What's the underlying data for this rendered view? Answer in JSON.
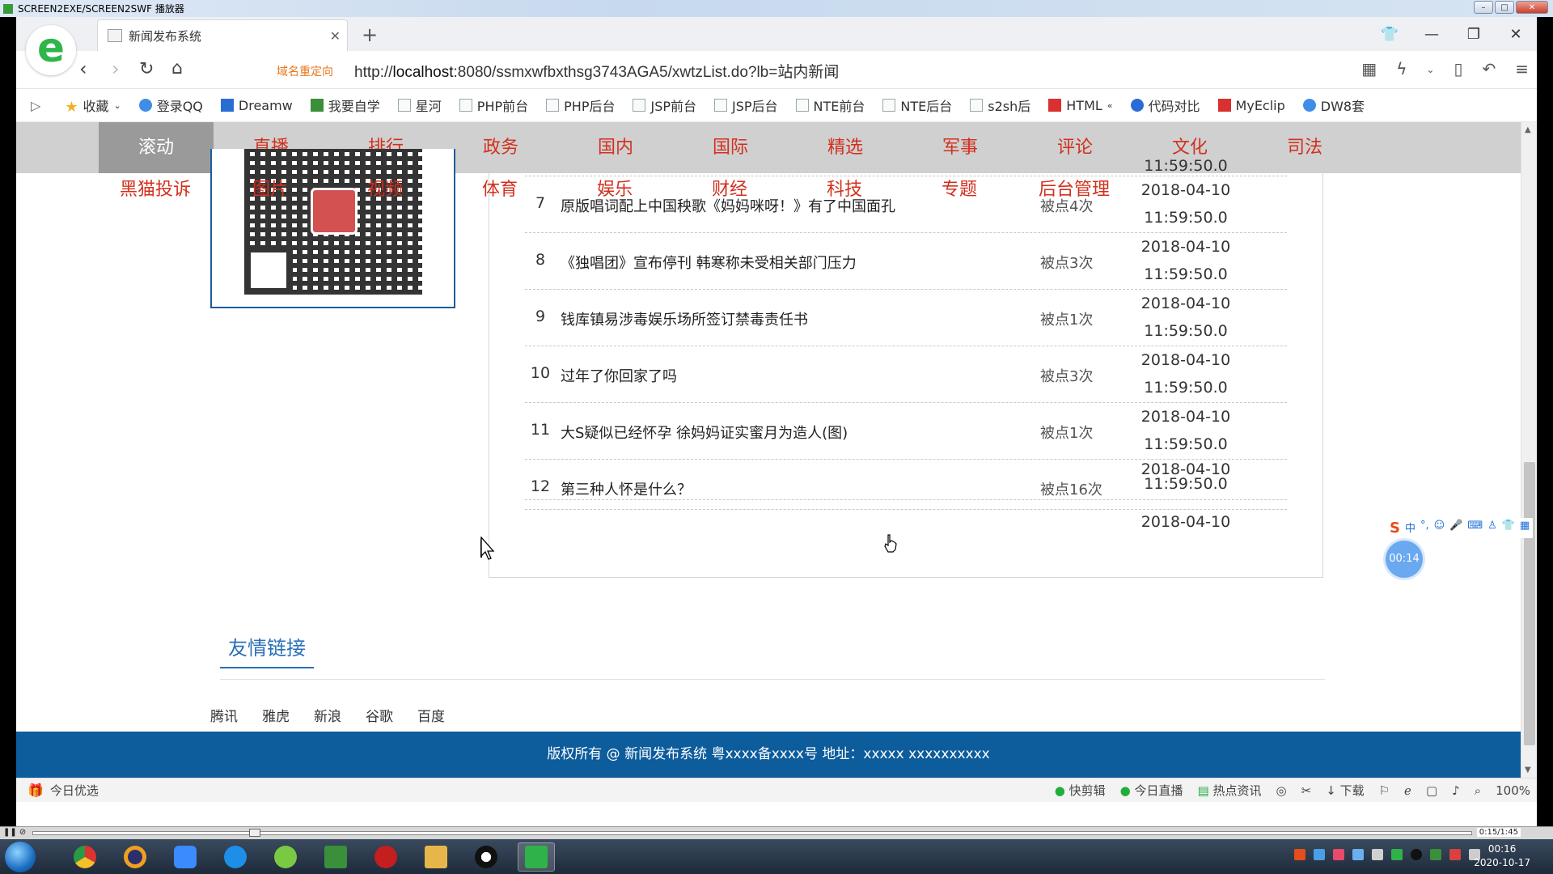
{
  "player": {
    "title": "SCREEN2EXE/SCREEN2SWF 播放器",
    "time": "0:15/1:45"
  },
  "browser": {
    "tab_title": "新闻发布系统",
    "redirect_label": "域名重定向",
    "url_prefix": "http://",
    "url_host": "localhost",
    "url_rest": ":8080/ssmxwfbxthsg3743AGA5/xwtzList.do?lb=站内新闻"
  },
  "bookmarks": [
    {
      "label": "收藏",
      "icon": "star-icon"
    },
    {
      "label": "登录QQ",
      "icon": "qq-icon"
    },
    {
      "label": "Dreamw",
      "icon": "dreamweaver-icon"
    },
    {
      "label": "我要自学",
      "icon": "book-icon"
    },
    {
      "label": "星河",
      "icon": "page-icon"
    },
    {
      "label": "PHP前台",
      "icon": "page-icon"
    },
    {
      "label": "PHP后台",
      "icon": "page-icon"
    },
    {
      "label": "JSP前台",
      "icon": "page-icon"
    },
    {
      "label": "JSP后台",
      "icon": "page-icon"
    },
    {
      "label": "NTE前台",
      "icon": "page-icon"
    },
    {
      "label": "NTE后台",
      "icon": "page-icon"
    },
    {
      "label": "s2sh后",
      "icon": "image-icon"
    },
    {
      "label": "HTML",
      "icon": "html-icon"
    },
    {
      "label": "代码对比",
      "icon": "compare-icon"
    },
    {
      "label": "MyEclip",
      "icon": "myeclipse-icon"
    },
    {
      "label": "DW8套",
      "icon": "gear-icon"
    }
  ],
  "menu": {
    "row1": [
      "滚动",
      "直播",
      "排行",
      "政务",
      "国内",
      "国际",
      "精选",
      "军事",
      "评论",
      "文化",
      "司法"
    ],
    "row2": [
      "黑猫投诉",
      "图片",
      "视频",
      "体育",
      "娱乐",
      "财经",
      "科技",
      "专题",
      "后台管理"
    ]
  },
  "news": {
    "partial_top_time": "11:59:50.0",
    "rows": [
      {
        "num": "7",
        "title": "原版唱词配上中国秧歌《妈妈咪呀！》有了中国面孔",
        "hits": "被点4次",
        "date": "2018-04-10",
        "time": "11:59:50.0"
      },
      {
        "num": "8",
        "title": "《独唱团》宣布停刊 韩寒称未受相关部门压力",
        "hits": "被点3次",
        "date": "2018-04-10",
        "time": "11:59:50.0"
      },
      {
        "num": "9",
        "title": "钱库镇易涉毒娱乐场所签订禁毒责任书",
        "hits": "被点1次",
        "date": "2018-04-10",
        "time": "11:59:50.0"
      },
      {
        "num": "10",
        "title": "过年了你回家了吗",
        "hits": "被点3次",
        "date": "2018-04-10",
        "time": "11:59:50.0"
      },
      {
        "num": "11",
        "title": "大S疑似已经怀孕 徐妈妈证实蜜月为造人(图)",
        "hits": "被点1次",
        "date": "2018-04-10",
        "time": "11:59:50.0"
      },
      {
        "num": "12",
        "title": "第三种人怀是什么？",
        "hits": "被点16次",
        "date": "2018-04-10",
        "time": "11:59:50.0"
      }
    ],
    "last_date": "2018-04-10"
  },
  "friends": {
    "title": "友情链接",
    "links": [
      "腾讯",
      "雅虎",
      "新浪",
      "谷歌",
      "百度"
    ]
  },
  "footer": {
    "text": "版权所有 @ 新闻发布系统 粤xxxx备xxxx号 地址：xxxxx xxxxxxxxxx"
  },
  "overlay": {
    "timer": "00:14",
    "ime_label": "中"
  },
  "statusbar": {
    "left": "今日优选",
    "items": [
      "快剪辑",
      "今日直播",
      "热点资讯",
      "下载"
    ],
    "zoom": "100%"
  },
  "taskbar": {
    "time": "00:16",
    "date": "2020-10-17"
  }
}
